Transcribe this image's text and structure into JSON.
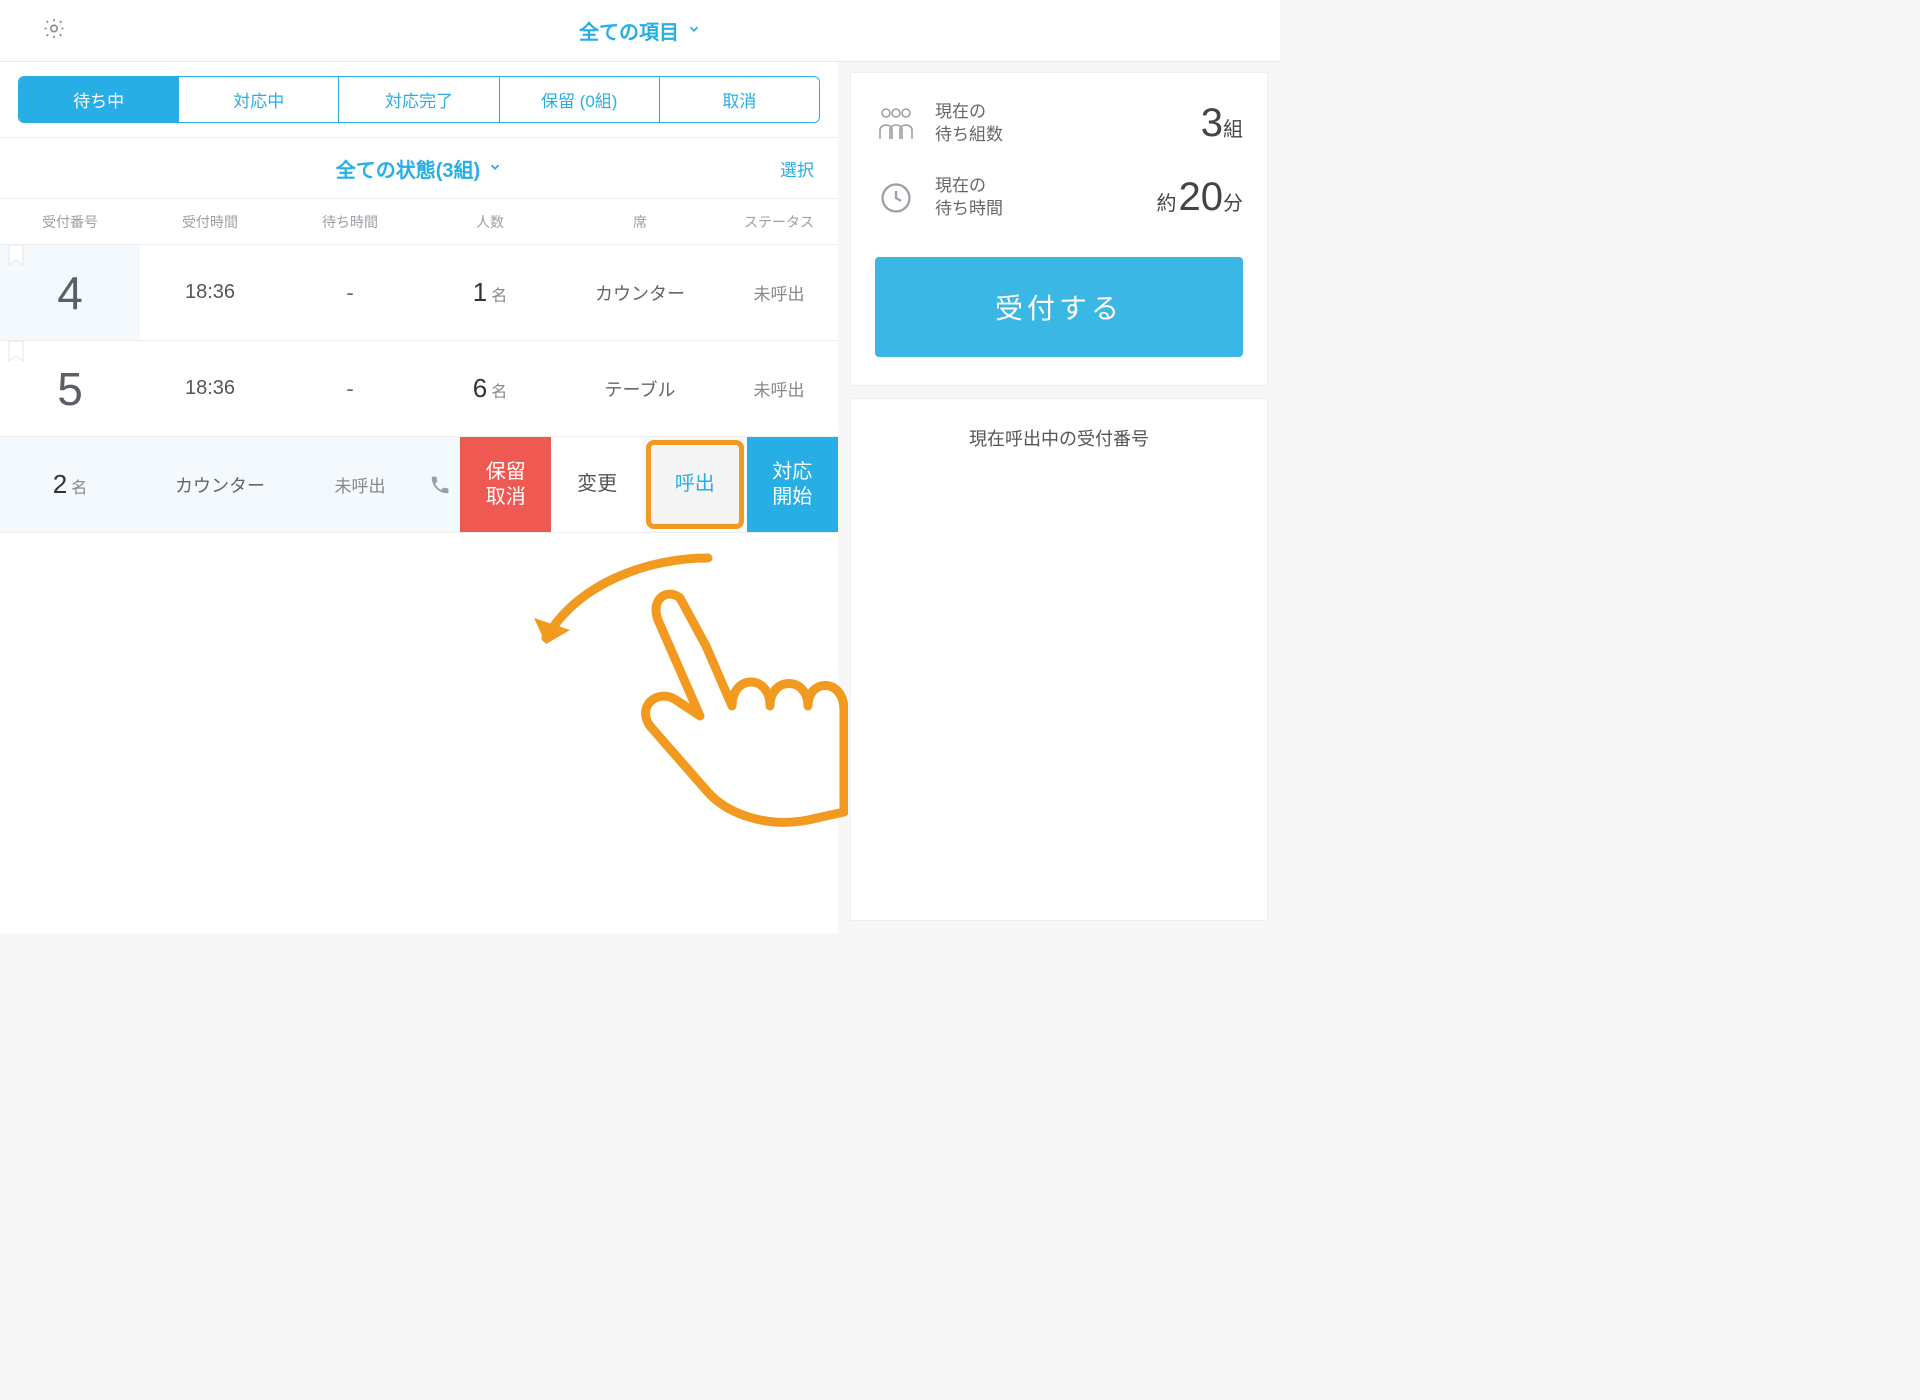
{
  "header": {
    "title": "全ての項目"
  },
  "tabs": {
    "waiting": "待ち中",
    "serving": "対応中",
    "done": "対応完了",
    "hold": "保留 (0組)",
    "cancelled": "取消"
  },
  "filter": {
    "label": "全ての状態(3組)",
    "select": "選択"
  },
  "columns": {
    "number": "受付番号",
    "time": "受付時間",
    "wait": "待ち時間",
    "people": "人数",
    "seat": "席",
    "status": "ステータス"
  },
  "unit_people": "名",
  "rows": [
    {
      "number": "4",
      "time": "18:36",
      "wait": "-",
      "people": "1",
      "seat": "カウンター",
      "status": "未呼出"
    },
    {
      "number": "5",
      "time": "18:36",
      "wait": "-",
      "people": "6",
      "seat": "テーブル",
      "status": "未呼出"
    }
  ],
  "swiped": {
    "people": "2",
    "seat": "カウンター",
    "status": "未呼出",
    "actions": {
      "hold_cancel": "保留\n取消",
      "edit": "変更",
      "call": "呼出",
      "start": "対応\n開始"
    }
  },
  "side": {
    "wait_groups_label": "現在の\n待ち組数",
    "wait_groups_value": "3",
    "wait_groups_unit": "組",
    "wait_time_label": "現在の\n待ち時間",
    "wait_time_prefix": "約",
    "wait_time_value": "20",
    "wait_time_unit": "分",
    "accept_button": "受付する",
    "calling_title": "現在呼出中の受付番号"
  }
}
